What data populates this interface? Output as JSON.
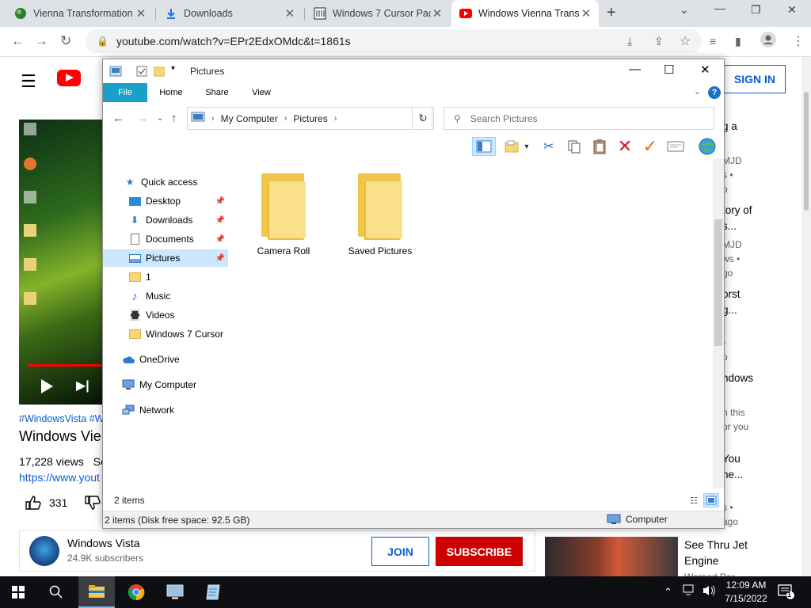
{
  "browser": {
    "tabs": [
      {
        "title": "Vienna Transformation",
        "active": false
      },
      {
        "title": "Downloads",
        "active": false
      },
      {
        "title": "Windows 7 Cursor Pack",
        "active": false
      },
      {
        "title": "Windows Vienna Trans",
        "active": true
      }
    ],
    "url": "youtube.com/watch?v=EPr2EdxOMdc&t=1861s",
    "new_tab": "+"
  },
  "youtube": {
    "signin_label": "SIGN IN",
    "hashtags": "#WindowsVista #W",
    "video_title": "Windows Vie",
    "views": "17,228 views",
    "views_suffix": "Se",
    "link": "https://www.yout",
    "likes": "331",
    "channel_name": "Windows Vista",
    "channel_subs": "24.9K subscribers",
    "join_label": "JOIN",
    "subscribe_label": "SUBSCRIBE",
    "sidebar_snippets": [
      {
        "text": "g a",
        "kind": "title"
      },
      {
        "text": "MJD",
        "kind": "meta"
      },
      {
        "text": "s •",
        "kind": "meta"
      },
      {
        "text": "o",
        "kind": "meta"
      },
      {
        "text": "tory of",
        "kind": "title"
      },
      {
        "text": "s...",
        "kind": "title"
      },
      {
        "text": "MJD",
        "kind": "meta"
      },
      {
        "text": "ws •",
        "kind": "meta"
      },
      {
        "text": "go",
        "kind": "meta"
      },
      {
        "text": "orst",
        "kind": "title"
      },
      {
        "text": "g...",
        "kind": "title"
      },
      {
        "text": "•",
        "kind": "meta"
      },
      {
        "text": "o",
        "kind": "meta"
      },
      {
        "text": "ndows",
        "kind": "title"
      },
      {
        "text": "n this",
        "kind": "meta"
      },
      {
        "text": "or you",
        "kind": "meta"
      },
      {
        "text": "You",
        "kind": "title"
      },
      {
        "text": "ne...",
        "kind": "title"
      },
      {
        "text": "s •",
        "kind": "meta"
      },
      {
        "text": "ago",
        "kind": "meta"
      }
    ],
    "jet_title": "See Thru Jet Engine",
    "jet_channel": "Warped Per..."
  },
  "explorer": {
    "window_title": "Pictures",
    "ribbon_tabs": [
      "File",
      "Home",
      "Share",
      "View"
    ],
    "help": "?",
    "breadcrumb": [
      "My Computer",
      "Pictures"
    ],
    "search_placeholder": "Search Pictures",
    "nav": {
      "quick_access": "Quick access",
      "items": [
        {
          "label": "Desktop",
          "pinned": true
        },
        {
          "label": "Downloads",
          "pinned": true
        },
        {
          "label": "Documents",
          "pinned": true
        },
        {
          "label": "Pictures",
          "pinned": true,
          "selected": true
        },
        {
          "label": "1",
          "pinned": false
        },
        {
          "label": "Music",
          "pinned": false
        },
        {
          "label": "Videos",
          "pinned": false
        },
        {
          "label": "Windows 7 Cursor",
          "pinned": false
        }
      ],
      "onedrive": "OneDrive",
      "my_computer": "My Computer",
      "network": "Network"
    },
    "folders": [
      {
        "name": "Camera Roll"
      },
      {
        "name": "Saved Pictures"
      }
    ],
    "status_items": "2 items",
    "status_disk": "2 items (Disk free space: 92.5 GB)",
    "status_location": "Computer"
  },
  "taskbar": {
    "time": "12:09 AM",
    "date": "7/15/2022",
    "notifications": "1"
  },
  "colors": {
    "ribbon_file": "#19a0c8",
    "selection": "#cce8ff",
    "youtube_red": "#cc0000",
    "youtube_blue": "#065fd4",
    "taskbar": "#0d0f13"
  }
}
